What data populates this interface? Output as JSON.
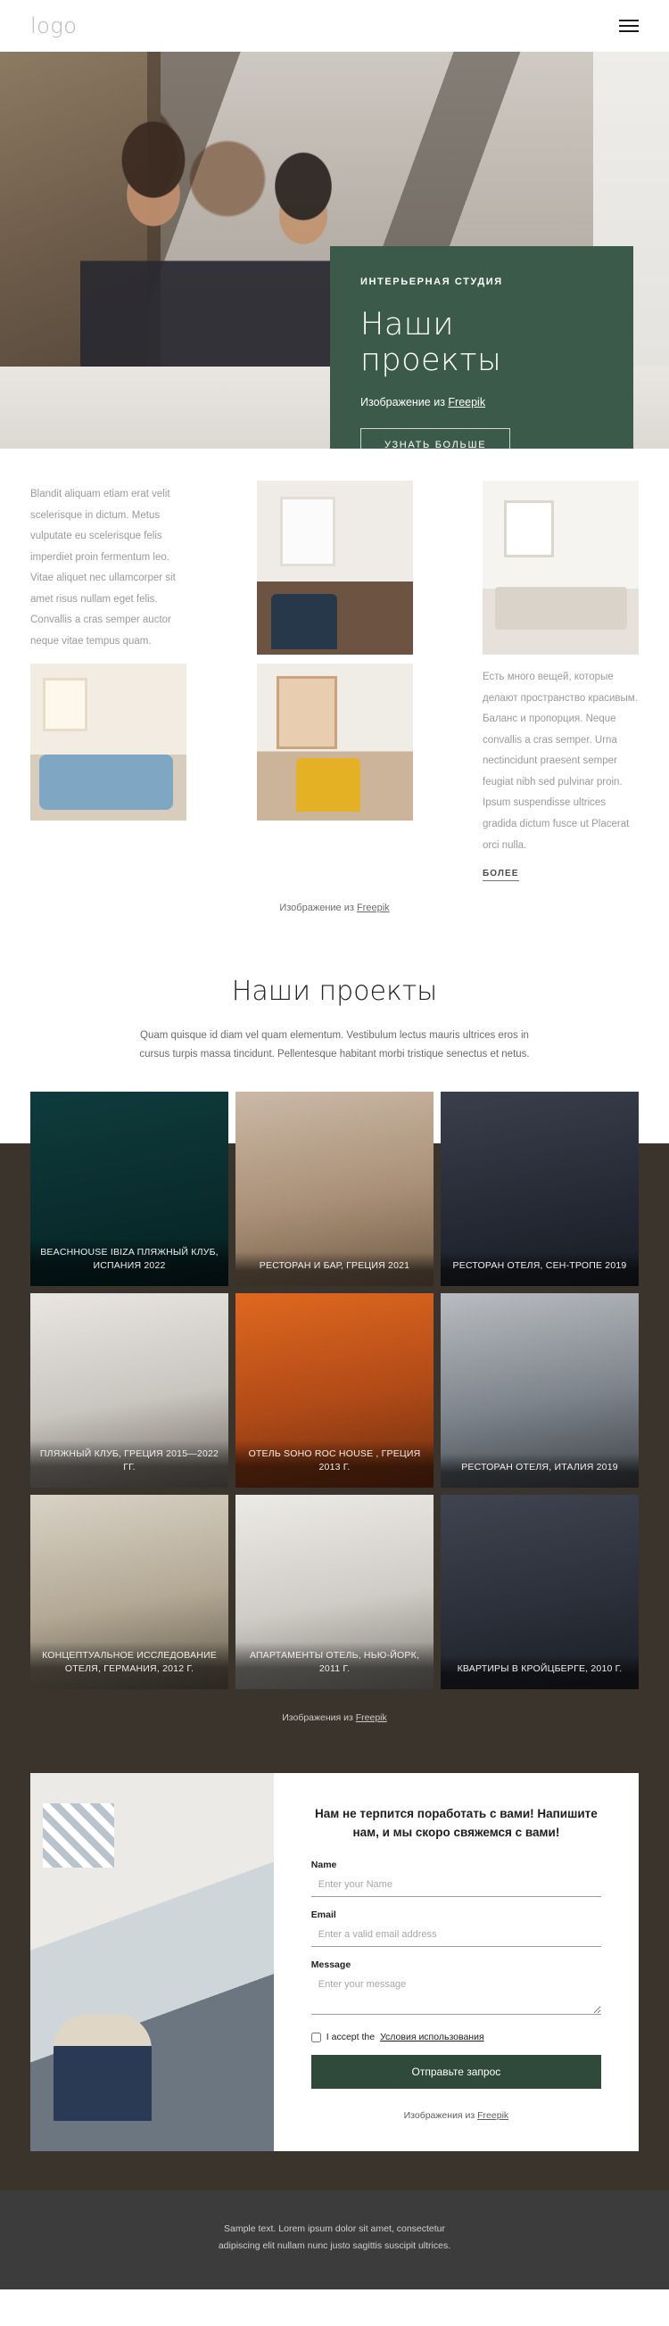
{
  "header": {
    "logo": "logo",
    "menu_icon": "hamburger-menu-icon"
  },
  "hero": {
    "kicker": "ИНТЕРЬЕРНАЯ СТУДИЯ",
    "title": "Наши проекты",
    "credit_prefix": "Изображение из ",
    "credit_link": "Freepik",
    "button": "УЗНАТЬ БОЛЬШЕ"
  },
  "section2": {
    "left_text": "Blandit aliquam etiam erat velit scelerisque in dictum. Metus vulputate eu scelerisque felis imperdiet proin fermentum leo. Vitae aliquet nec ullamcorper sit amet risus nullam eget felis. Convallis a cras semper auctor neque vitae tempus quam.",
    "right_text": "Есть много вещей, которые делают пространство красивым. Баланс и пропорция. Neque convallis a cras semper. Urna nectincidunt praesent semper feugiat nibh sed pulvinar proin. Ipsum suspendisse ultrices gradida dictum fusce ut Placerat orci nulla.",
    "more_label": "БОЛЕЕ",
    "credit_prefix": "Изображение из ",
    "credit_link": "Freepik"
  },
  "projects": {
    "heading": "Наши проекты",
    "description": "Quam quisque id diam vel quam elementum. Vestibulum lectus mauris ultrices eros in cursus turpis massa tincidunt. Pellentesque habitant morbi tristique senectus et netus.",
    "cards": [
      {
        "caption": "BEACHHOUSE IBIZA ПЛЯЖНЫЙ КЛУБ, ИСПАНИЯ 2022"
      },
      {
        "caption": "РЕСТОРАН И БАР, ГРЕЦИЯ 2021"
      },
      {
        "caption": "РЕСТОРАН ОТЕЛЯ, СЕН-ТРОПЕ 2019"
      },
      {
        "caption": "ПЛЯЖНЫЙ КЛУБ, ГРЕЦИЯ 2015—2022 ГГ."
      },
      {
        "caption": "ОТЕЛЬ SOHO ROC HOUSE , ГРЕЦИЯ 2013 Г."
      },
      {
        "caption": "РЕСТОРАН ОТЕЛЯ, ИТАЛИЯ 2019"
      },
      {
        "caption": "КОНЦЕПТУАЛЬНОЕ ИССЛЕДОВАНИЕ ОТЕЛЯ, ГЕРМАНИЯ, 2012 Г."
      },
      {
        "caption": "АПАРТАМЕНТЫ ОТЕЛЬ, НЬЮ-ЙОРК, 2011 Г."
      },
      {
        "caption": "КВАРТИРЫ В КРОЙЦБЕРГЕ, 2010 Г."
      }
    ],
    "credit_prefix": "Изображения из ",
    "credit_link": "Freepik"
  },
  "contact": {
    "title": "Нам не терпится поработать с вами! Напишите нам, и мы скоро свяжемся с вами!",
    "name_label": "Name",
    "name_placeholder": "Enter your Name",
    "email_label": "Email",
    "email_placeholder": "Enter a valid email address",
    "message_label": "Message",
    "message_placeholder": "Enter your message",
    "accept_prefix": "I accept the ",
    "accept_link": "Условия использования",
    "submit": "Отправьте запрос",
    "credit_prefix": "Изображения из ",
    "credit_link": "Freepik"
  },
  "footer": {
    "line1": "Sample text. Lorem ipsum dolor sit amet, consectetur",
    "line2": "adipiscing elit nullam nunc justo sagittis suscipit ultrices."
  },
  "colors": {
    "accent_green": "#3b5a49",
    "dark_bg": "#3a342d",
    "footer_bg": "#3c3c3c"
  }
}
